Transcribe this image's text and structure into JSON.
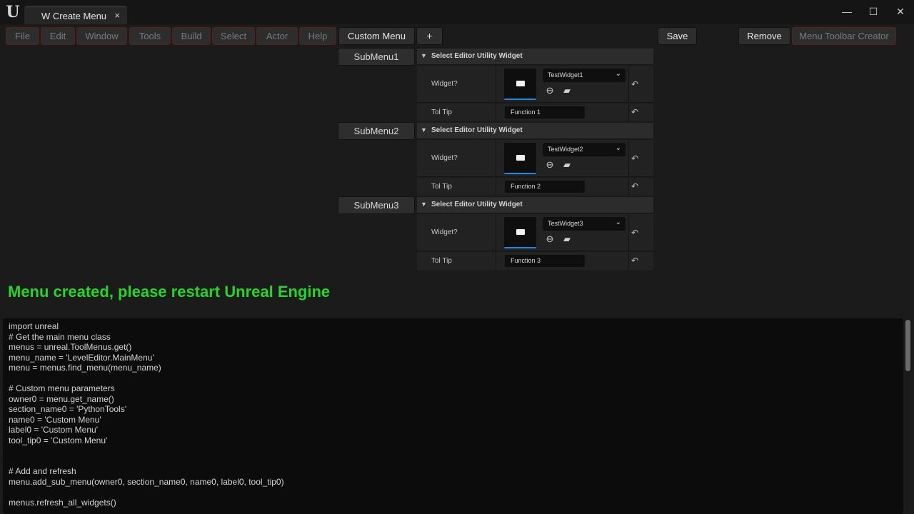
{
  "window": {
    "logo": "U",
    "tab_title": "W Create Menu",
    "tab_close": "×",
    "minimize": "—",
    "maximize": "☐",
    "close": "✕"
  },
  "menubar": {
    "items": [
      "File",
      "Edit",
      "Window",
      "Tools",
      "Build",
      "Select",
      "Actor",
      "Help"
    ],
    "custom_menu": "Custom Menu",
    "add": "+",
    "save": "Save",
    "remove": "Remove",
    "toolbar_creator": "Menu Toolbar Creator"
  },
  "submenus": [
    {
      "button": "SubMenu1",
      "header": "Select Editor Utility Widget",
      "widget_label": "Widget?",
      "widget_value": "TestWidget1",
      "tip_label": "Tol Tip",
      "tip_value": "Function 1"
    },
    {
      "button": "SubMenu2",
      "header": "Select Editor Utility Widget",
      "widget_label": "Widget?",
      "widget_value": "TestWidget2",
      "tip_label": "Tol Tip",
      "tip_value": "Function 2"
    },
    {
      "button": "SubMenu3",
      "header": "Select Editor Utility Widget",
      "widget_label": "Widget?",
      "widget_value": "TestWidget3",
      "tip_label": "Tol Tip",
      "tip_value": "Function 3"
    }
  ],
  "status_message": "Menu created, please restart Unreal Engine",
  "code_lines": [
    "import unreal",
    "# Get the main menu class",
    "menus = unreal.ToolMenus.get()",
    "menu_name = 'LevelEditor.MainMenu'",
    "menu = menus.find_menu(menu_name)",
    "",
    "# Custom menu parameters",
    "owner0 = menu.get_name()",
    "section_name0 = 'PythonTools'",
    "name0 = 'Custom Menu'",
    "label0 = 'Custom Menu'",
    "tool_tip0 = 'Custom Menu'",
    "",
    "",
    "# Add and refresh",
    "menu.add_sub_menu(owner0, section_name0, name0, label0, tool_tip0)",
    "",
    "menus.refresh_all_widgets()"
  ],
  "colors": {
    "status_green": "#26d626",
    "accent_blue": "#1e88e5",
    "disabled_border": "#5a1f1f"
  }
}
